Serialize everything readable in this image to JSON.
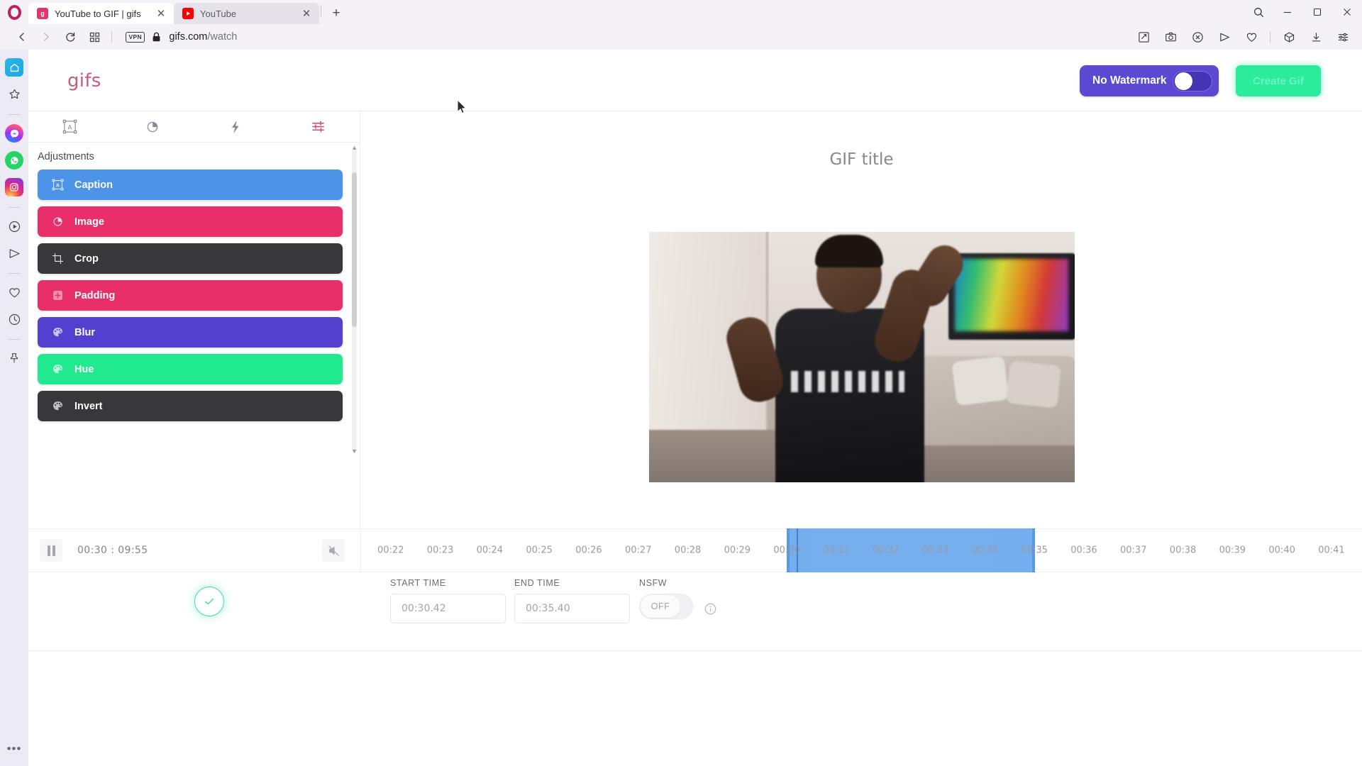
{
  "browser": {
    "name": "opera",
    "tabs": [
      {
        "title": "YouTube to GIF | gifs",
        "favicon": "gifs-icon",
        "active": true,
        "close_label": "✕"
      },
      {
        "title": "YouTube",
        "favicon": "youtube-icon",
        "active": false,
        "close_label": "✕"
      }
    ],
    "new_tab_label": "+",
    "window_controls": {
      "minimize": "—",
      "maximize": "❐",
      "close": "✕"
    },
    "address": {
      "vpn_badge": "VPN",
      "domain": "gifs.com",
      "path": "/watch"
    },
    "nav": {
      "back": "back-icon",
      "forward": "forward-icon",
      "reload": "reload-icon",
      "tabs_grid": "tab-grid-icon"
    },
    "toolbar_icons": [
      "pin-page-icon",
      "snapshot-icon",
      "ad-block-icon",
      "send-icon",
      "heart-icon",
      "crypto-wallet-icon",
      "downloads-icon",
      "easy-setup-icon"
    ],
    "sidebar_icons": [
      "home-icon",
      "star-icon",
      "messenger-icon",
      "whatsapp-icon",
      "instagram-icon",
      "player-icon",
      "telegram-icon",
      "heart-icon",
      "history-icon",
      "pin-icon"
    ],
    "sidebar_menu": "•••"
  },
  "app": {
    "logo": "gifs",
    "watermark": {
      "label": "No Watermark",
      "state": "on"
    },
    "create_button": "Create Gif",
    "tool_tabs": [
      {
        "name": "caption-tool",
        "icon": "caption-icon",
        "active": false
      },
      {
        "name": "image-tool",
        "icon": "image-drop-icon",
        "active": false
      },
      {
        "name": "effects-tool",
        "icon": "lightning-icon",
        "active": false
      },
      {
        "name": "adjustments-tool",
        "icon": "sliders-icon",
        "active": true
      }
    ],
    "panel": {
      "title": "Adjustments",
      "items": [
        {
          "label": "Caption",
          "color": "#4d93e8",
          "icon": "caption-icon"
        },
        {
          "label": "Image",
          "color": "#e82f69",
          "icon": "image-drop-icon"
        },
        {
          "label": "Crop",
          "color": "#38383c",
          "icon": "crop-icon"
        },
        {
          "label": "Padding",
          "color": "#e82f69",
          "icon": "padding-icon"
        },
        {
          "label": "Blur",
          "color": "#5340cf",
          "icon": "palette-icon"
        },
        {
          "label": "Hue",
          "color": "#21e98f",
          "icon": "palette-icon"
        },
        {
          "label": "Invert",
          "color": "#38383c",
          "icon": "palette-icon"
        }
      ]
    },
    "preview": {
      "title": "GIF title"
    },
    "player": {
      "state": "paused",
      "current_time": "00:30",
      "total_time": "09:55",
      "time_separator": ":",
      "muted": true
    },
    "timeline": {
      "ticks": [
        "00:22",
        "00:23",
        "00:24",
        "00:25",
        "00:26",
        "00:27",
        "00:28",
        "00:29",
        "00:30",
        "00:31",
        "00:32",
        "00:33",
        "00:34",
        "00:35",
        "00:36",
        "00:37",
        "00:38",
        "00:39",
        "00:40",
        "00:41"
      ],
      "selection_start_tick": "00:30",
      "selection_end_tick": "00:35",
      "selection_color": "#6aa8ed"
    },
    "form": {
      "confirm_icon": "check-circle-icon",
      "start_time": {
        "label": "START TIME",
        "value": "00:30.42"
      },
      "end_time": {
        "label": "END TIME",
        "value": "00:35.40"
      },
      "nsfw": {
        "label": "NSFW",
        "state": "OFF",
        "info_icon": "info-icon"
      }
    }
  }
}
